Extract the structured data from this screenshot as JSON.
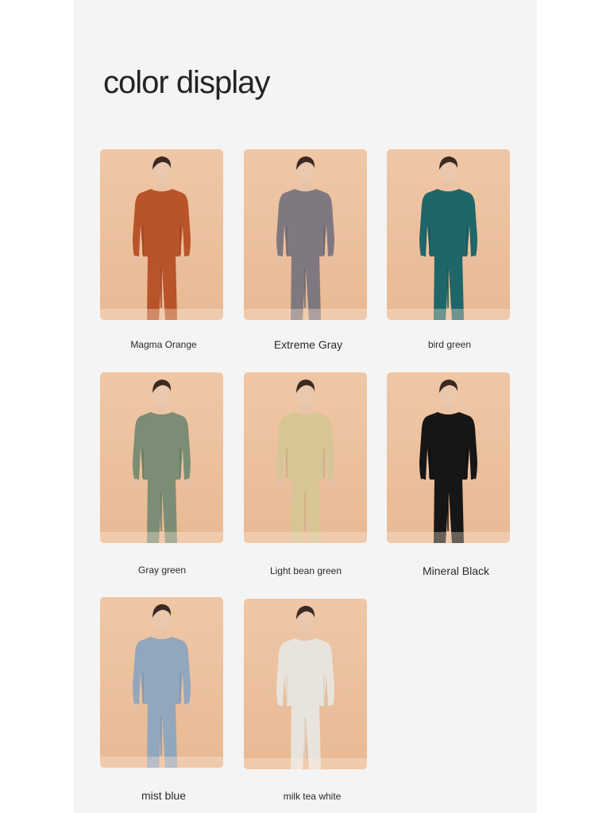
{
  "page": {
    "title": "color display",
    "colors": {
      "panel": "#f5f4f4",
      "card_background": "#ebbf9c"
    }
  },
  "products": [
    {
      "label": "Magma Orange",
      "garment_color": "#b9532a",
      "garment_shadow": "#9e4422"
    },
    {
      "label": "Extreme Gray",
      "garment_color": "#807880",
      "garment_shadow": "#6c656c"
    },
    {
      "label": "bird green",
      "garment_color": "#1f6668",
      "garment_shadow": "#175455"
    },
    {
      "label": "Gray green",
      "garment_color": "#7b8d74",
      "garment_shadow": "#687a62"
    },
    {
      "label": "Light bean green",
      "garment_color": "#d8c596",
      "garment_shadow": "#c3b082"
    },
    {
      "label": "Mineral Black",
      "garment_color": "#161616",
      "garment_shadow": "#0c0c0c"
    },
    {
      "label": "mist blue",
      "garment_color": "#93a7bc",
      "garment_shadow": "#8094aa"
    },
    {
      "label": "milk tea white",
      "garment_color": "#e8e4dd",
      "garment_shadow": "#d7d2ca"
    }
  ]
}
